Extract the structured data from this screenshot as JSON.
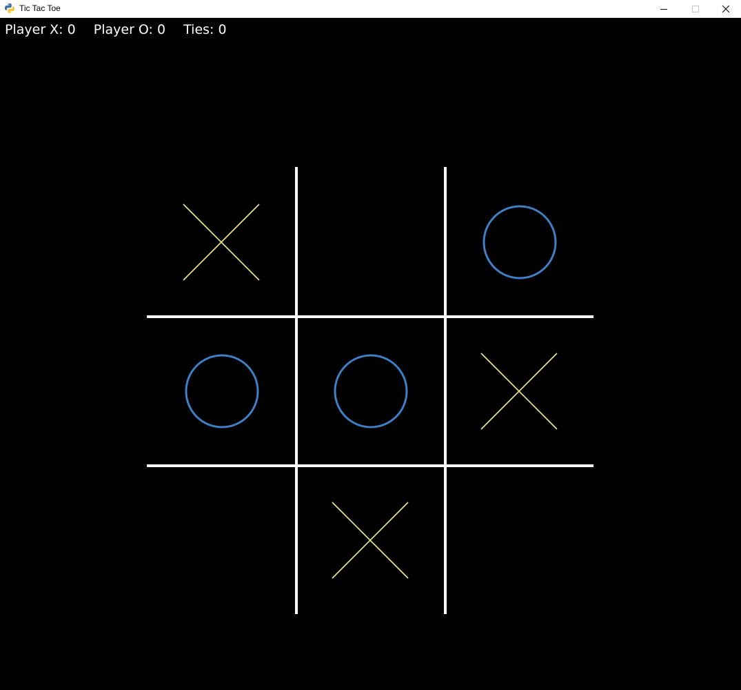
{
  "window": {
    "title": "Tic Tac Toe"
  },
  "scores": [
    {
      "key": "x",
      "label": "Player X: ",
      "value": "0"
    },
    {
      "key": "o",
      "label": "Player O: ",
      "value": "0"
    },
    {
      "key": "ties",
      "label": "Ties: ",
      "value": "0"
    }
  ],
  "board": {
    "cells": [
      [
        "X",
        "",
        "O"
      ],
      [
        "O",
        "O",
        "X"
      ],
      [
        "",
        "X",
        ""
      ]
    ]
  },
  "colors": {
    "background": "#000000",
    "grid": "#ffffff",
    "x_mark": "#f5ee8a",
    "o_mark": "#3f7fc6",
    "text": "#ffffff"
  },
  "icons": {
    "app": "python-icon",
    "minimize": "minimize-icon",
    "maximize": "maximize-icon",
    "close": "close-icon"
  }
}
